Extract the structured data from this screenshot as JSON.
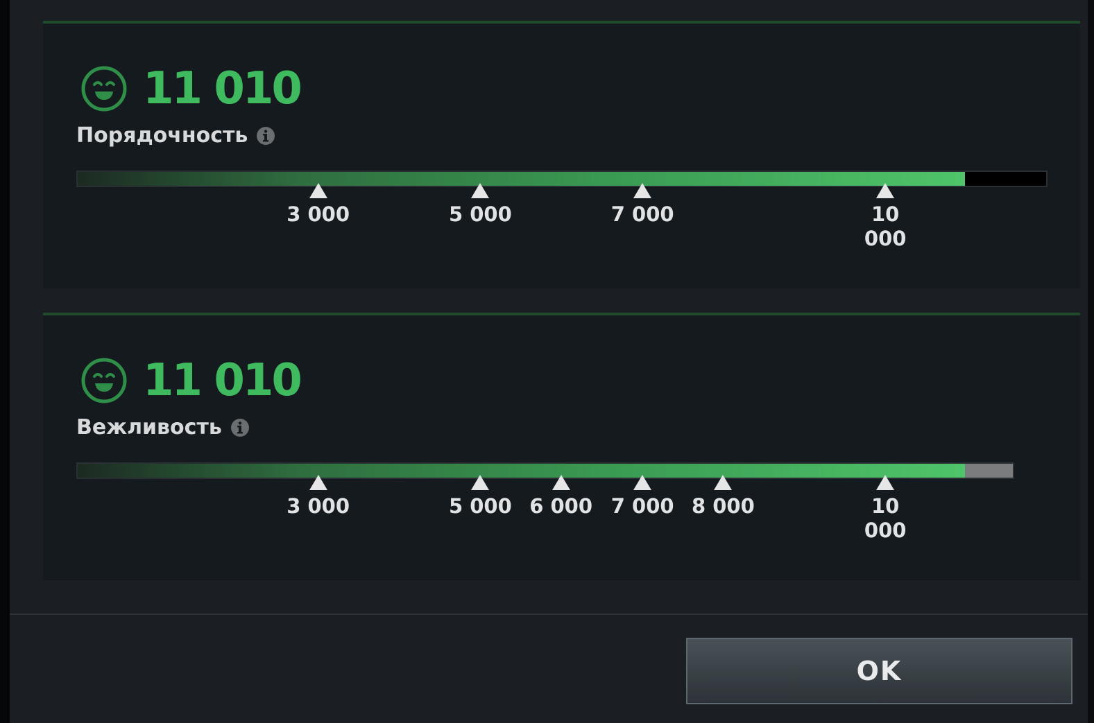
{
  "metrics": [
    {
      "score": "11 010",
      "label": "Порядочность",
      "progress_fraction": 0.916,
      "remainder_fraction": 1.0,
      "remainder_color": "#000000",
      "thresholds": [
        {
          "label": "3 000",
          "position_fraction": 0.249
        },
        {
          "label": "5 000",
          "position_fraction": 0.416
        },
        {
          "label": "7 000",
          "position_fraction": 0.583
        },
        {
          "label": "10 000",
          "position_fraction": 0.833
        }
      ]
    },
    {
      "score": "11 010",
      "label": "Вежливость",
      "progress_fraction": 0.916,
      "remainder_fraction": 0.966,
      "remainder_color": "#7b7c7d",
      "thresholds": [
        {
          "label": "3 000",
          "position_fraction": 0.249
        },
        {
          "label": "5 000",
          "position_fraction": 0.416
        },
        {
          "label": "6 000",
          "position_fraction": 0.499
        },
        {
          "label": "7 000",
          "position_fraction": 0.583
        },
        {
          "label": "8 000",
          "position_fraction": 0.666
        },
        {
          "label": "10 000",
          "position_fraction": 0.833
        }
      ]
    }
  ],
  "icons": {
    "score": "smiling-face-icon",
    "info": "info-icon"
  },
  "colors": {
    "score_green": "#3fba5e",
    "bar_green": "#4fc46a"
  },
  "ok_button": {
    "label": "OK"
  }
}
